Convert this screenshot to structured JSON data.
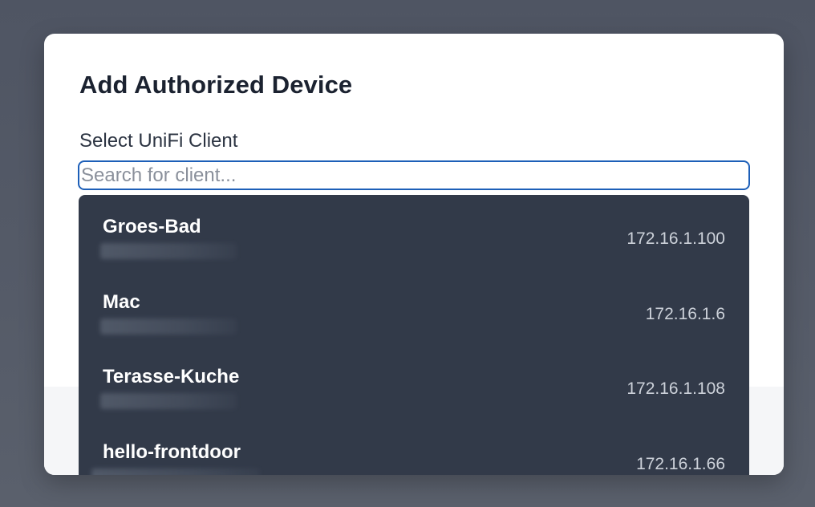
{
  "modal": {
    "title": "Add Authorized Device"
  },
  "field": {
    "label": "Select UniFi Client",
    "search_placeholder": "Search for client...",
    "search_value": ""
  },
  "clients": [
    {
      "name": "Groes-Bad",
      "ip": "172.16.1.100"
    },
    {
      "name": "Mac",
      "ip": "172.16.1.6"
    },
    {
      "name": "Terasse-Kuche",
      "ip": "172.16.1.108"
    },
    {
      "name": "hello-frontdoor",
      "ip": "172.16.1.66"
    }
  ]
}
